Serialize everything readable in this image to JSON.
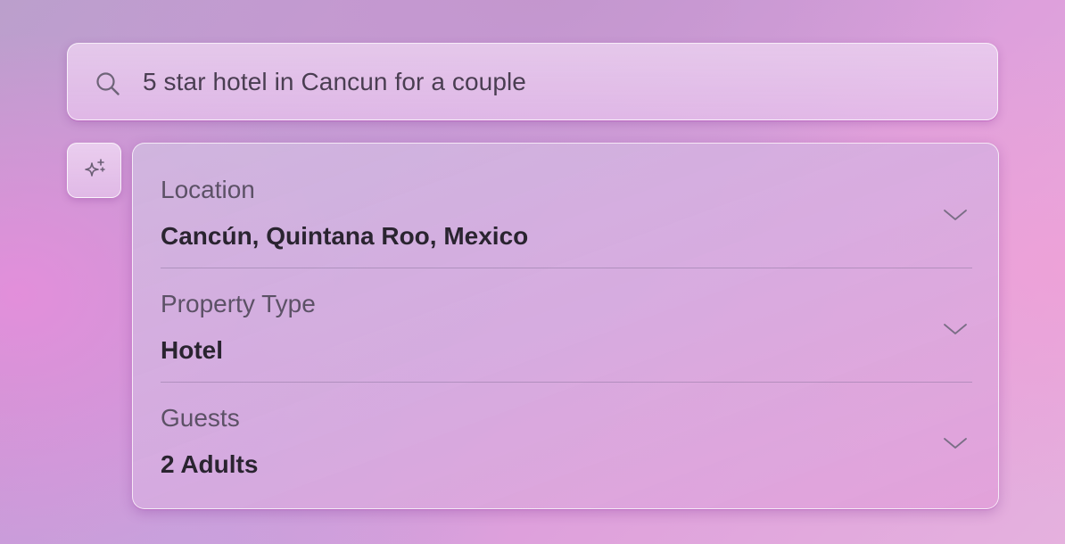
{
  "search": {
    "query": "5 star hotel in Cancun for a couple",
    "icon": "search-icon"
  },
  "ai_button": {
    "icon": "sparkles-icon"
  },
  "filters": [
    {
      "label": "Location",
      "value": "Cancún, Quintana Roo, Mexico",
      "icon": "chevron-down-icon"
    },
    {
      "label": "Property Type",
      "value": "Hotel",
      "icon": "chevron-down-icon"
    },
    {
      "label": "Guests",
      "value": "2 Adults",
      "icon": "chevron-down-icon"
    }
  ],
  "colors": {
    "label_text": "#5c5166",
    "value_text": "#2a2430",
    "divider": "#8a7a98"
  }
}
